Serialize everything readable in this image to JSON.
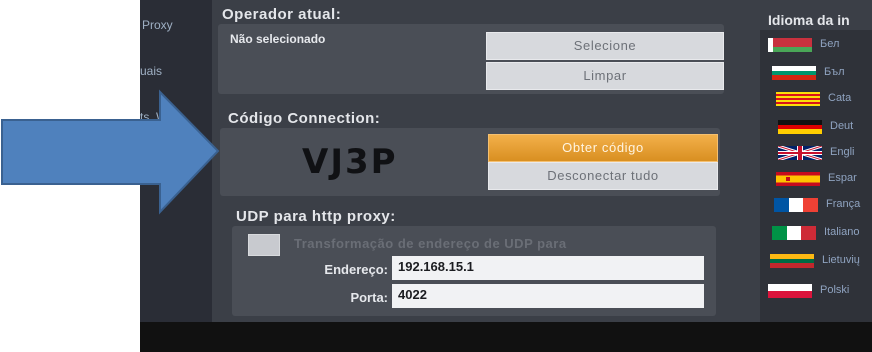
{
  "sidebar": {
    "items": [
      "Proxy",
      "uais",
      "ts. Wlec"
    ]
  },
  "operator": {
    "title": "Operador atual:",
    "status": "Não selecionado",
    "select_label": "Selecione",
    "clear_label": "Limpar"
  },
  "connection": {
    "title": "Código Connection:",
    "code": "VJ3P",
    "get_code_label": "Obter código",
    "disconnect_label": "Desconectar tudo"
  },
  "udp": {
    "title": "UDP para http proxy:",
    "checkbox_label": "Transformação de endereço de UDP para",
    "address_label": "Endereço:",
    "address_value": "192.168.15.1",
    "port_label": "Porta:",
    "port_value": "4022"
  },
  "language": {
    "title": "Idioma da in",
    "items": [
      {
        "label": "Бел",
        "flag": "belarus-flag"
      },
      {
        "label": "Бъл",
        "flag": "bulgaria-flag"
      },
      {
        "label": "Cata",
        "flag": "catalonia-flag"
      },
      {
        "label": "Deut",
        "flag": "germany-flag"
      },
      {
        "label": "Engli",
        "flag": "uk-flag"
      },
      {
        "label": "Espar",
        "flag": "spain-flag"
      },
      {
        "label": "França",
        "flag": "france-flag"
      },
      {
        "label": "Italiano",
        "flag": "italy-flag"
      },
      {
        "label": "Lietuvių",
        "flag": "lithuania-flag"
      },
      {
        "label": "Polski",
        "flag": "poland-flag"
      }
    ]
  },
  "colors": {
    "arrow": "#4f81bd",
    "orange_button": "#e8a234",
    "screen_bg": "#3b3f47"
  }
}
